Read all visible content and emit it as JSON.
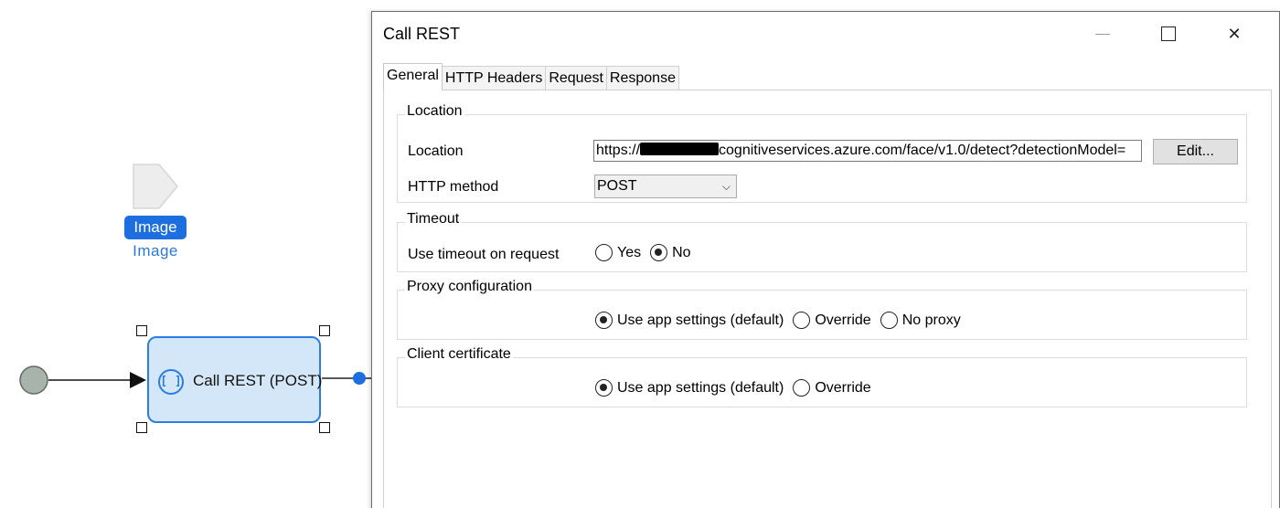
{
  "canvas": {
    "parameter": {
      "tag": "Image",
      "name": "Image"
    },
    "activity": {
      "icon": "rest-call-icon",
      "glyph": "[ ]",
      "label": "Call REST (POST)"
    },
    "colors": {
      "accent": "#2a7de1",
      "activity_fill": "#d4e7f8",
      "start_event": "#a8b3ac"
    }
  },
  "dialog": {
    "title": "Call REST",
    "controls": {
      "minimize": "minimize-icon",
      "maximize": "maximize-icon",
      "close": "close-icon",
      "close_glyph": "✕"
    },
    "tabs": [
      {
        "label": "General",
        "active": true
      },
      {
        "label": "HTTP Headers",
        "active": false
      },
      {
        "label": "Request",
        "active": false
      },
      {
        "label": "Response",
        "active": false
      }
    ],
    "location_group": {
      "title": "Location",
      "location_label": "Location",
      "location_prefix": "https://",
      "location_suffix": "cognitiveservices.azure.com/face/v1.0/detect?detectionModel=",
      "edit_button": "Edit...",
      "method_label": "HTTP method",
      "method_value": "POST",
      "chevron": "⌵"
    },
    "timeout_group": {
      "title": "Timeout",
      "label": "Use timeout on request",
      "options": [
        {
          "label": "Yes",
          "selected": false
        },
        {
          "label": "No",
          "selected": true
        }
      ]
    },
    "proxy_group": {
      "title": "Proxy configuration",
      "options": [
        {
          "label": "Use app settings (default)",
          "selected": true
        },
        {
          "label": "Override",
          "selected": false
        },
        {
          "label": "No proxy",
          "selected": false
        }
      ]
    },
    "certificate_group": {
      "title": "Client certificate",
      "options": [
        {
          "label": "Use app settings (default)",
          "selected": true
        },
        {
          "label": "Override",
          "selected": false
        }
      ]
    }
  }
}
